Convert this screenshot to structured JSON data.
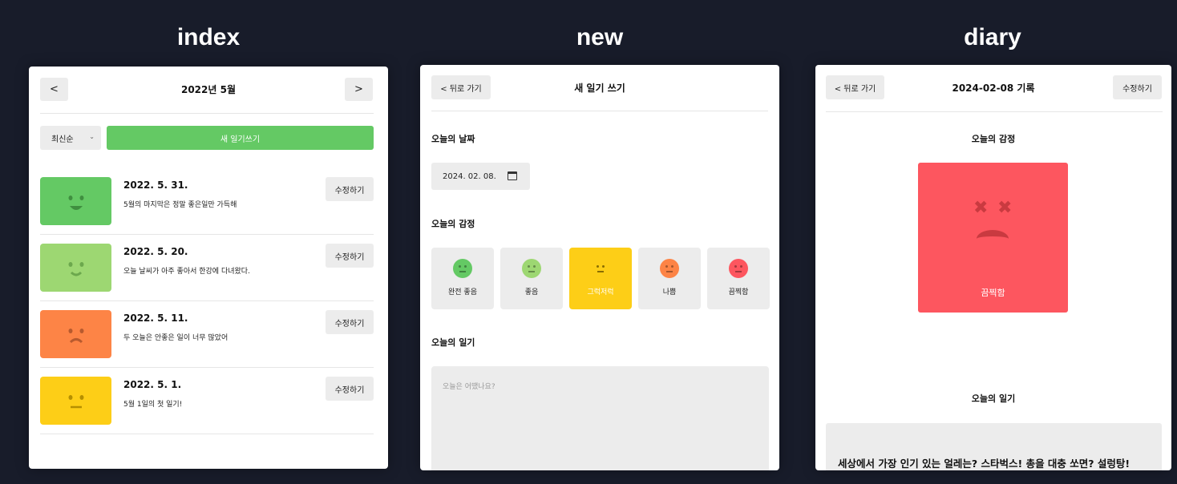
{
  "titles": {
    "index": "index",
    "new": "new",
    "diary": "diary"
  },
  "colors": {
    "background": "#181c2a",
    "emotion_1": "#64c964",
    "emotion_2": "#9dd772",
    "emotion_3": "#fdce17",
    "emotion_4": "#fd8446",
    "emotion_5": "#fd565f",
    "new_button": "#64c964"
  },
  "index": {
    "prev": "<",
    "next": ">",
    "month_title": "2022년 5월",
    "sort_value": "최신순",
    "new_button": "새 일기쓰기",
    "items": [
      {
        "date": "2022. 5. 31.",
        "content": "5월의 마지막은 정말 좋은일만 가득해",
        "edit": "수정하기",
        "emotion": 1
      },
      {
        "date": "2022. 5. 20.",
        "content": "오늘 날씨가 아주 좋아서 한강에 다녀왔다.",
        "edit": "수정하기",
        "emotion": 2
      },
      {
        "date": "2022. 5. 11.",
        "content": "두 오늘은 안좋은 일이 너무 많았어",
        "edit": "수정하기",
        "emotion": 4
      },
      {
        "date": "2022. 5. 1.",
        "content": "5월 1일의 첫 일기!",
        "edit": "수정하기",
        "emotion": 3
      }
    ]
  },
  "new": {
    "back": "< 뒤로 가기",
    "title": "새 일기 쓰기",
    "date_label": "오늘의 날짜",
    "date_value": "2024. 02. 08.",
    "emotion_label": "오늘의 감정",
    "emotions": [
      {
        "name": "완전 좋음"
      },
      {
        "name": "좋음"
      },
      {
        "name": "그럭저럭"
      },
      {
        "name": "나쁨"
      },
      {
        "name": "끔찍함"
      }
    ],
    "selected_emotion": 3,
    "diary_label": "오늘의 일기",
    "placeholder": "오늘은 어땠나요?"
  },
  "diary": {
    "back": "< 뒤로 가기",
    "title": "2024-02-08 기록",
    "edit": "수정하기",
    "emotion_label": "오늘의 감정",
    "emotion_name": "끔찍함",
    "diary_label": "오늘의 일기",
    "content": "세상에서 가장 인기 있는 얼레는? 스타벅스! 총을 대충 쏘면? 설렁탕!"
  }
}
